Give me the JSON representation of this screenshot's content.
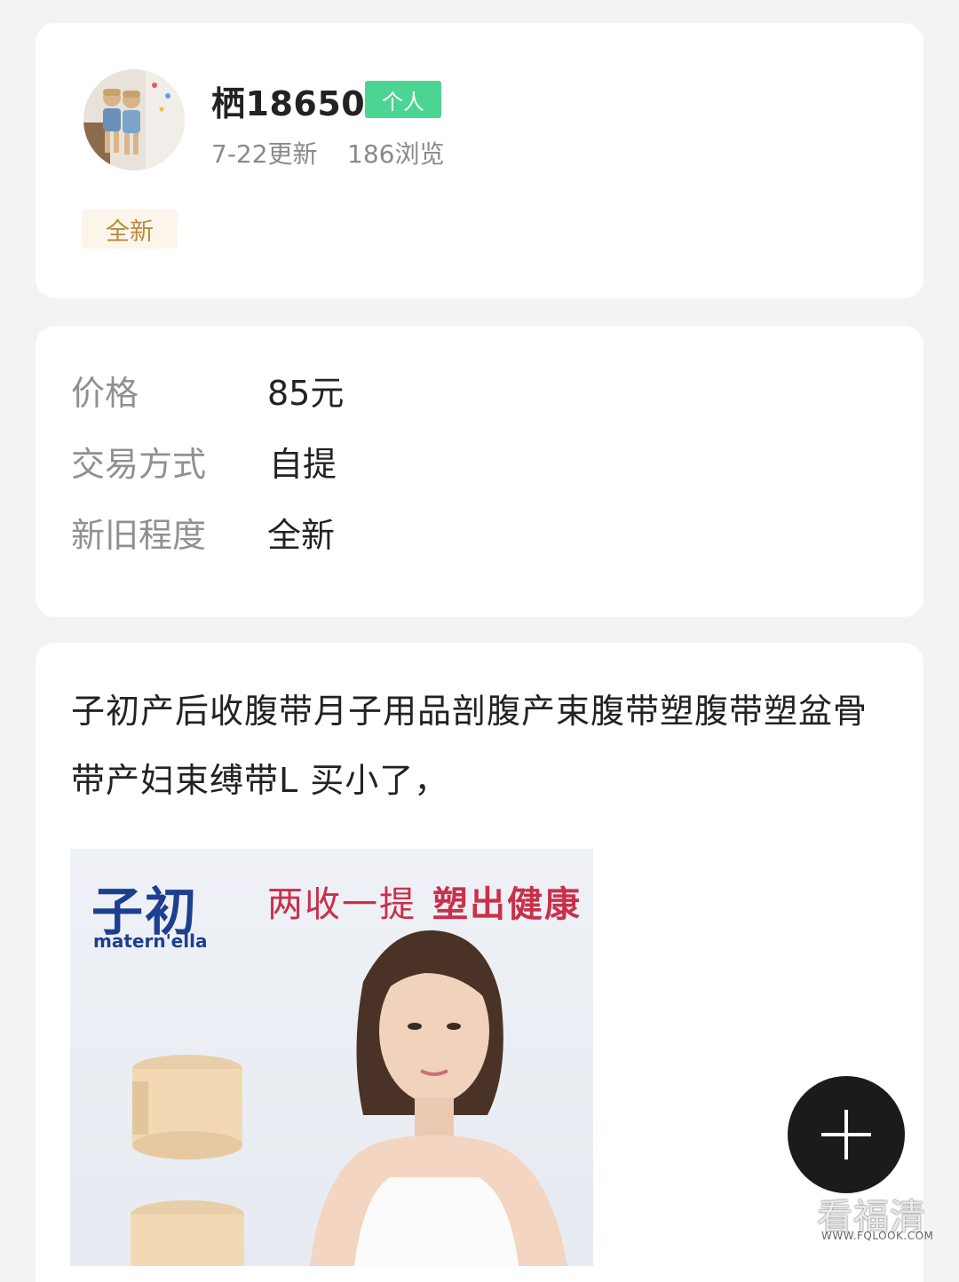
{
  "seller": {
    "username": "栖18650",
    "badge": "个人",
    "updated": "7-22更新",
    "views": "186浏览",
    "condition_tag": "全新"
  },
  "details": {
    "rows": [
      {
        "label": "价格",
        "value": "85元"
      },
      {
        "label": "交易方式",
        "value": "自提"
      },
      {
        "label": "新旧程度",
        "value": "全新"
      }
    ]
  },
  "description": {
    "text": "子初产后收腹带月子用品剖腹产束腹带塑腹带塑盆骨带产妇束缚带L 买小了，"
  },
  "product_image": {
    "brand_cn": "子初",
    "brand_en": "matern'ella",
    "slogan_part1": "两收一提",
    "slogan_part2": "塑出健康"
  },
  "fab": {
    "icon": "plus-icon"
  },
  "watermark": {
    "text": "看福清",
    "url": "WWW.FQLOOK.COM"
  },
  "colors": {
    "badge_green": "#4cd592",
    "tag_bg": "#fbf5ea",
    "tag_text": "#b98a3c",
    "slogan_red": "#c9304a",
    "brand_blue": "#1d3f8f"
  }
}
